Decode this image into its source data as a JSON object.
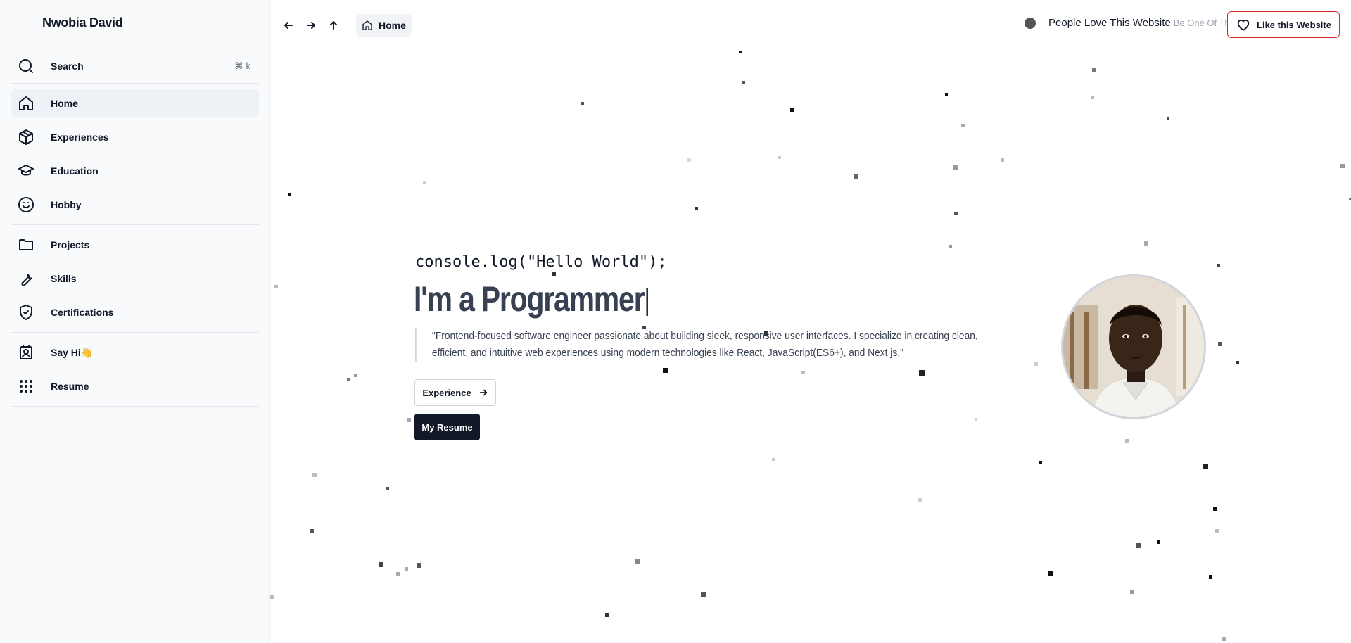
{
  "sidebar": {
    "brand": "Nwobia David",
    "search": {
      "label": "Search",
      "shortcut": "⌘ k"
    },
    "items": [
      {
        "label": "Home",
        "icon": "home-icon"
      },
      {
        "label": "Experiences",
        "icon": "box-icon"
      },
      {
        "label": "Education",
        "icon": "graduation-cap-icon"
      },
      {
        "label": "Hobby",
        "icon": "smile-icon"
      },
      {
        "label": "Projects",
        "icon": "folder-icon"
      },
      {
        "label": "Skills",
        "icon": "wrench-icon"
      },
      {
        "label": "Certifications",
        "icon": "shield-check-icon"
      },
      {
        "label": "Say Hi👋",
        "icon": "contact-icon"
      },
      {
        "label": "Resume",
        "icon": "grid-dots-icon"
      }
    ]
  },
  "topbar": {
    "breadcrumb": "Home",
    "love_text": "People Love This Website",
    "love_sub": "Be One Of Them",
    "like_button": "Like this Website"
  },
  "hero": {
    "console": "console.log(\"Hello World\");",
    "headline": "I'm a Programmer",
    "quote": "\"Frontend-focused software engineer passionate about building sleek, responsive user interfaces. I specialize in creating clean, efficient, and intuitive web experiences using modern technologies like React, JavaScript(ES6+), and Next js.\"",
    "experience_button": "Experience",
    "resume_button": "My Resume"
  },
  "colors": {
    "sidebar_bg": "#f8fafc",
    "accent_red": "#dc2626",
    "dark": "#111827"
  }
}
